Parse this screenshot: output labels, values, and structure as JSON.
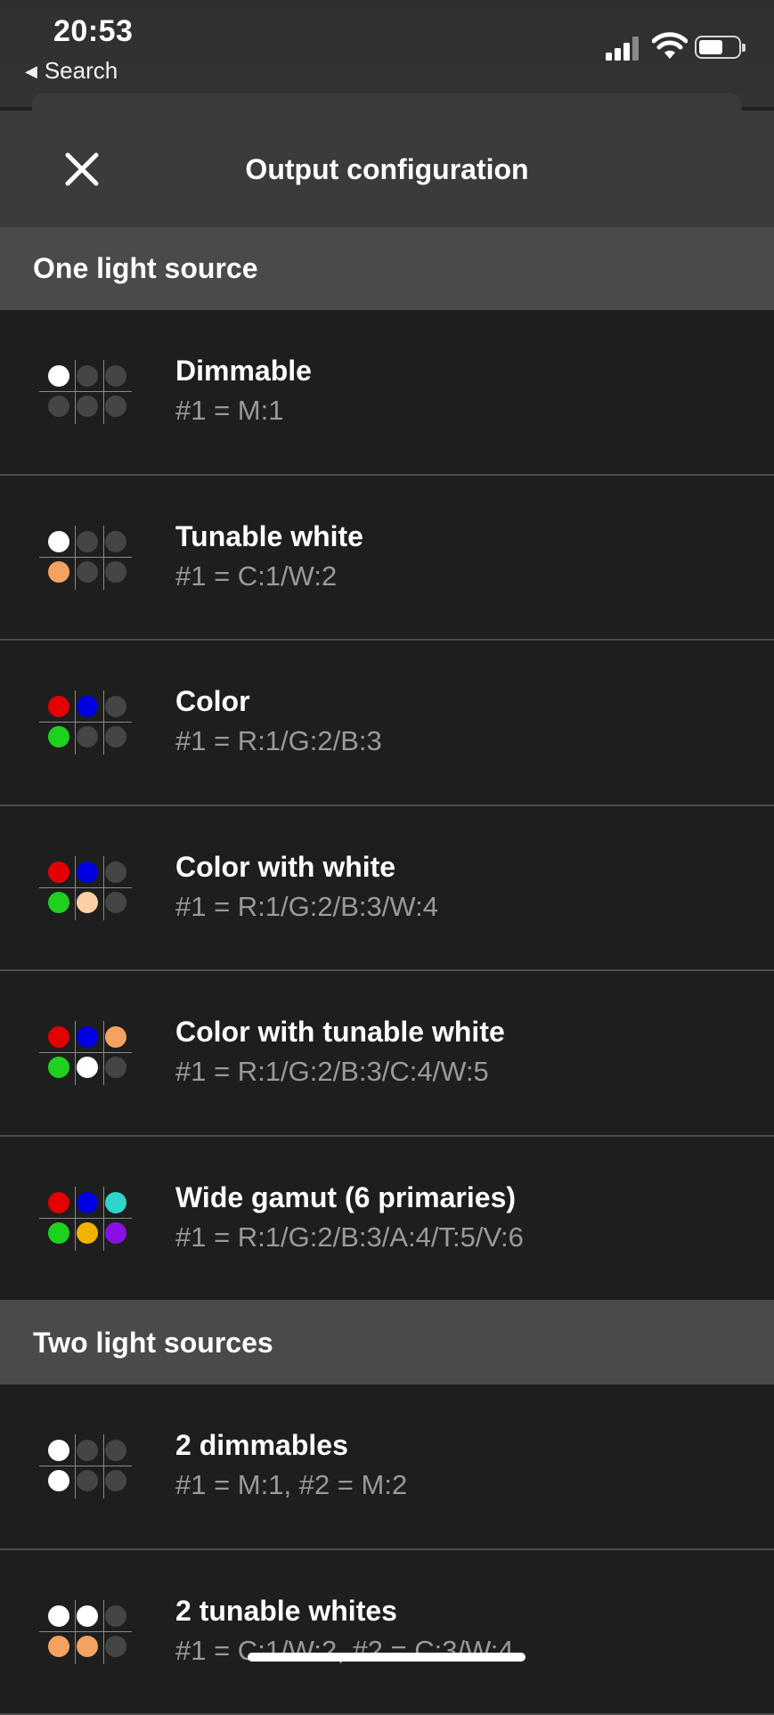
{
  "status_bar": {
    "time": "20:53",
    "back_label": "Search"
  },
  "header": {
    "title": "Output configuration"
  },
  "colors": {
    "white": "#ffffff",
    "off": "#454545",
    "amber": "#f4a261",
    "red": "#e40000",
    "green": "#1fd11f",
    "blue": "#0000e0",
    "peach": "#fcd0a6",
    "cyan": "#2fd4cc",
    "yellow": "#f2b200",
    "violet": "#8a10e6"
  },
  "sections": [
    {
      "title": "One light source",
      "items": [
        {
          "name": "Dimmable",
          "code": "#1 = M:1",
          "dots": [
            "white",
            "off",
            "off",
            "off",
            "off",
            "off"
          ]
        },
        {
          "name": "Tunable white",
          "code": "#1 = C:1/W:2",
          "dots": [
            "white",
            "off",
            "off",
            "amber",
            "off",
            "off"
          ]
        },
        {
          "name": "Color",
          "code": "#1 = R:1/G:2/B:3",
          "dots": [
            "red",
            "blue",
            "off",
            "green",
            "off",
            "off"
          ]
        },
        {
          "name": "Color with white",
          "code": "#1 = R:1/G:2/B:3/W:4",
          "dots": [
            "red",
            "blue",
            "off",
            "green",
            "peach",
            "off"
          ]
        },
        {
          "name": "Color with tunable white",
          "code": "#1 = R:1/G:2/B:3/C:4/W:5",
          "dots": [
            "red",
            "blue",
            "amber",
            "green",
            "white",
            "off"
          ]
        },
        {
          "name": "Wide gamut (6 primaries)",
          "code": "#1 = R:1/G:2/B:3/A:4/T:5/V:6",
          "dots": [
            "red",
            "blue",
            "cyan",
            "green",
            "yellow",
            "violet"
          ]
        }
      ]
    },
    {
      "title": "Two light sources",
      "items": [
        {
          "name": "2 dimmables",
          "code": "#1 = M:1, #2 = M:2",
          "dots": [
            "white",
            "off",
            "off",
            "white",
            "off",
            "off"
          ]
        },
        {
          "name": "2 tunable whites",
          "code": "#1 = C:1/W:2, #2 = C:3/W:4",
          "dots": [
            "white",
            "white",
            "off",
            "amber",
            "amber",
            "off"
          ]
        }
      ]
    }
  ]
}
